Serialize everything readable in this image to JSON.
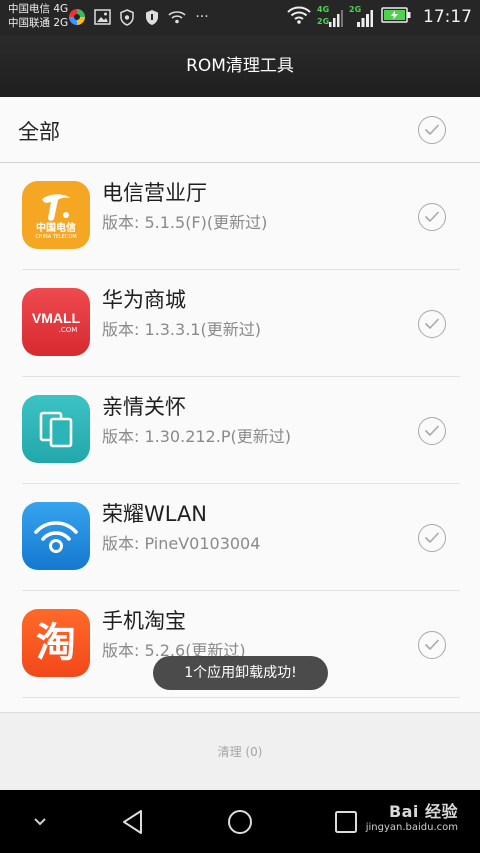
{
  "status_bar": {
    "carrier_1": "中国电信 4G",
    "carrier_2": "中国联通 2G",
    "net_1": "4G",
    "net_2": "2G",
    "net_3": "2G",
    "time": "17:17",
    "more": "···"
  },
  "header": {
    "title": "ROM清理工具"
  },
  "select_all": {
    "label": "全部"
  },
  "apps": [
    {
      "name": "电信营业厅",
      "version": "版本: 5.1.5(F)(更新过)",
      "icon": "china-telecom-icon",
      "icon_text": "中国电信",
      "icon_subtext": "CHINA TELECOM",
      "color": "#f5a623"
    },
    {
      "name": "华为商城",
      "version": "版本: 1.3.3.1(更新过)",
      "icon": "vmall-icon",
      "icon_text": "VMALL",
      "icon_subtext": ".COM",
      "color": "#e8353a"
    },
    {
      "name": "亲情关怀",
      "version": "版本: 1.30.212.P(更新过)",
      "icon": "family-care-icon",
      "color": "#2bb5b8"
    },
    {
      "name": "荣耀WLAN",
      "version": "版本: PineV0103004",
      "icon": "honor-wlan-icon",
      "color": "#1e8fe0"
    },
    {
      "name": "手机淘宝",
      "version": "版本: 5.2.6(更新过)",
      "icon": "taobao-icon",
      "icon_text": "淘",
      "color": "#ff5a1f"
    }
  ],
  "clean_button": {
    "label": "清理 (0)"
  },
  "toast": {
    "message": "1个应用卸载成功!"
  },
  "watermark": {
    "main": "Bai 经验",
    "sub": "jingyan.baidu.com"
  }
}
